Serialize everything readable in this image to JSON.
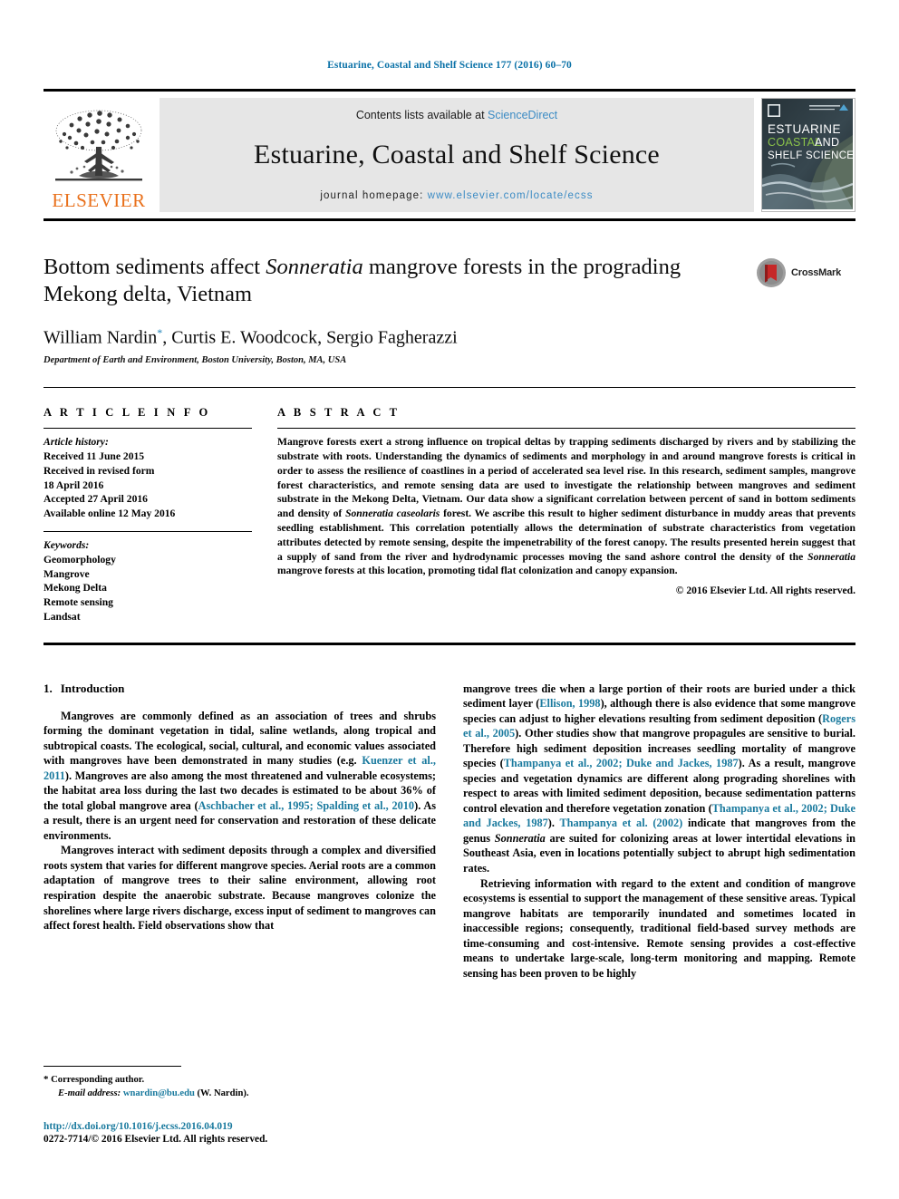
{
  "running_head": "Estuarine, Coastal and Shelf Science 177 (2016) 60–70",
  "masthead": {
    "publisher_wordmark": "ELSEVIER",
    "contents_prefix": "Contents lists available at ",
    "contents_link": "ScienceDirect",
    "journal_title": "Estuarine, Coastal and Shelf Science",
    "homepage_prefix": "journal homepage: ",
    "homepage_url": "www.elsevier.com/locate/ecss",
    "cover": {
      "line1": "ESTUARINE",
      "line2a": "COASTAL",
      "line2b": "AND",
      "line3": "SHELF SCIENCE"
    }
  },
  "title_block": {
    "title_part1": "Bottom sediments affect ",
    "title_species": "Sonneratia",
    "title_part2": " mangrove forests in the prograding Mekong delta, Vietnam",
    "authors": "William Nardin",
    "author_star": "*",
    "authors_rest": ", Curtis E. Woodcock, Sergio Fagherazzi",
    "affiliation": "Department of Earth and Environment, Boston University, Boston, MA, USA",
    "crossmark_label": "CrossMark"
  },
  "article_info": {
    "heading": "A R T I C L E   I N F O",
    "history_label": "Article history:",
    "history": [
      "Received 11 June 2015",
      "Received in revised form",
      "18 April 2016",
      "Accepted 27 April 2016",
      "Available online 12 May 2016"
    ],
    "keywords_label": "Keywords:",
    "keywords": [
      "Geomorphology",
      "Mangrove",
      "Mekong Delta",
      "Remote sensing",
      "Landsat"
    ]
  },
  "abstract": {
    "heading": "A B S T R A C T",
    "p1": "Mangrove forests exert a strong influence on tropical deltas by trapping sediments discharged by rivers and by stabilizing the substrate with roots. Understanding the dynamics of sediments and morphology in and around mangrove forests is critical in order to assess the resilience of coastlines in a period of accelerated sea level rise. In this research, sediment samples, mangrove forest characteristics, and remote sensing data are used to investigate the relationship between mangroves and sediment substrate in the Mekong Delta, Vietnam. Our data show a significant correlation between percent of sand in bottom sediments and density of ",
    "species1": "Sonneratia caseolaris",
    "p2": " forest. We ascribe this result to higher sediment disturbance in muddy areas that prevents seedling establishment. This correlation potentially allows the determination of substrate characteristics from vegetation attributes detected by remote sensing, despite the impenetrability of the forest canopy. The results presented herein suggest that a supply of sand from the river and hydrodynamic processes moving the sand ashore control the density of the ",
    "species2": "Sonneratia",
    "p3": " mangrove forests at this location, promoting tidal flat colonization and canopy expansion.",
    "copyright": "© 2016 Elsevier Ltd. All rights reserved."
  },
  "introduction": {
    "number": "1.",
    "title": "Introduction",
    "left": {
      "p1_a": "Mangroves are commonly defined as an association of trees and shrubs forming the dominant vegetation in tidal, saline wetlands, along tropical and subtropical coasts. The ecological, social, cultural, and economic values associated with mangroves have been demonstrated in many studies (e.g. ",
      "p1_cite1": "Kuenzer et al., 2011",
      "p1_b": "). Mangroves are also among the most threatened and vulnerable ecosystems; the habitat area loss during the last two decades is estimated to be about 36% of the total global mangrove area (",
      "p1_cite2": "Aschbacher et al., 1995; Spalding et al., 2010",
      "p1_c": "). As a result, there is an urgent need for conservation and restoration of these delicate environments.",
      "p2": "Mangroves interact with sediment deposits through a complex and diversified roots system that varies for different mangrove species. Aerial roots are a common adaptation of mangrove trees to their saline environment, allowing root respiration despite the anaerobic substrate. Because mangroves colonize the shorelines where large rivers discharge, excess input of sediment to mangroves can affect forest health. Field observations show that"
    },
    "right": {
      "p1_a": "mangrove trees die when a large portion of their roots are buried under a thick sediment layer (",
      "p1_cite1": "Ellison, 1998",
      "p1_b": "), although there is also evidence that some mangrove species can adjust to higher elevations resulting from sediment deposition (",
      "p1_cite2": "Rogers et al., 2005",
      "p1_c": "). Other studies show that mangrove propagules are sensitive to burial. Therefore high sediment deposition increases seedling mortality of mangrove species (",
      "p1_cite3": "Thampanya et al., 2002; Duke and Jackes, 1987",
      "p1_d": "). As a result, mangrove species and vegetation dynamics are different along prograding shorelines with respect to areas with limited sediment deposition, because sedimentation patterns control elevation and therefore vegetation zonation (",
      "p1_cite4": "Thampanya et al., 2002; Duke and Jackes, 1987",
      "p1_e": "). ",
      "p1_cite5": "Thampanya et al. (2002)",
      "p1_f": " indicate that mangroves from the genus ",
      "p1_species": "Sonneratia",
      "p1_g": " are suited for colonizing areas at lower intertidal elevations in Southeast Asia, even in locations potentially subject to abrupt high sedimentation rates.",
      "p2": "Retrieving information with regard to the extent and condition of mangrove ecosystems is essential to support the management of these sensitive areas. Typical mangrove habitats are temporarily inundated and sometimes located in inaccessible regions; consequently, traditional field-based survey methods are time-consuming and cost-intensive. Remote sensing provides a cost-effective means to undertake large-scale, long-term monitoring and mapping. Remote sensing has been proven to be highly"
    }
  },
  "footnotes": {
    "corresponding_star": "*",
    "corresponding_text": " Corresponding author.",
    "email_label": "E-mail address:",
    "email": "wnardin@bu.edu",
    "email_suffix": " (W. Nardin).",
    "doi": "http://dx.doi.org/10.1016/j.ecss.2016.04.019",
    "issn_line": "0272-7714/© 2016 Elsevier Ltd. All rights reserved."
  },
  "colors": {
    "link_blue": "#1a7a9e",
    "sd_blue": "#3b8bc4",
    "elsevier_orange": "#E9711C",
    "band_gray": "#e6e6e6"
  }
}
